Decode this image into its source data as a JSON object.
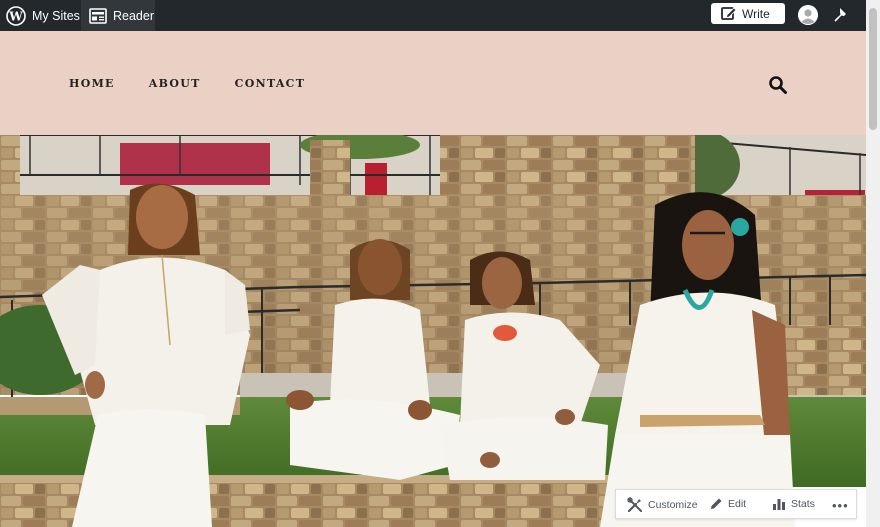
{
  "adminbar": {
    "my_sites_label": "My Sites",
    "reader_label": "Reader",
    "write_label": "Write",
    "bg_color": "#23282d",
    "icons": [
      "wordpress-icon",
      "reader-icon",
      "write-icon",
      "avatar-icon",
      "notifications-icon"
    ]
  },
  "header": {
    "bg_color": "#ebd0c5",
    "nav": [
      "HOME",
      "ABOUT",
      "CONTACT"
    ],
    "search_icon": "search-icon"
  },
  "hero": {
    "description_icon": "photo"
  },
  "actionbar": {
    "customize_label": "Customize",
    "edit_label": "Edit",
    "stats_label": "Stats",
    "more_label": "•••",
    "icons": [
      "customize-icon",
      "edit-icon",
      "stats-icon",
      "more-icon"
    ]
  }
}
